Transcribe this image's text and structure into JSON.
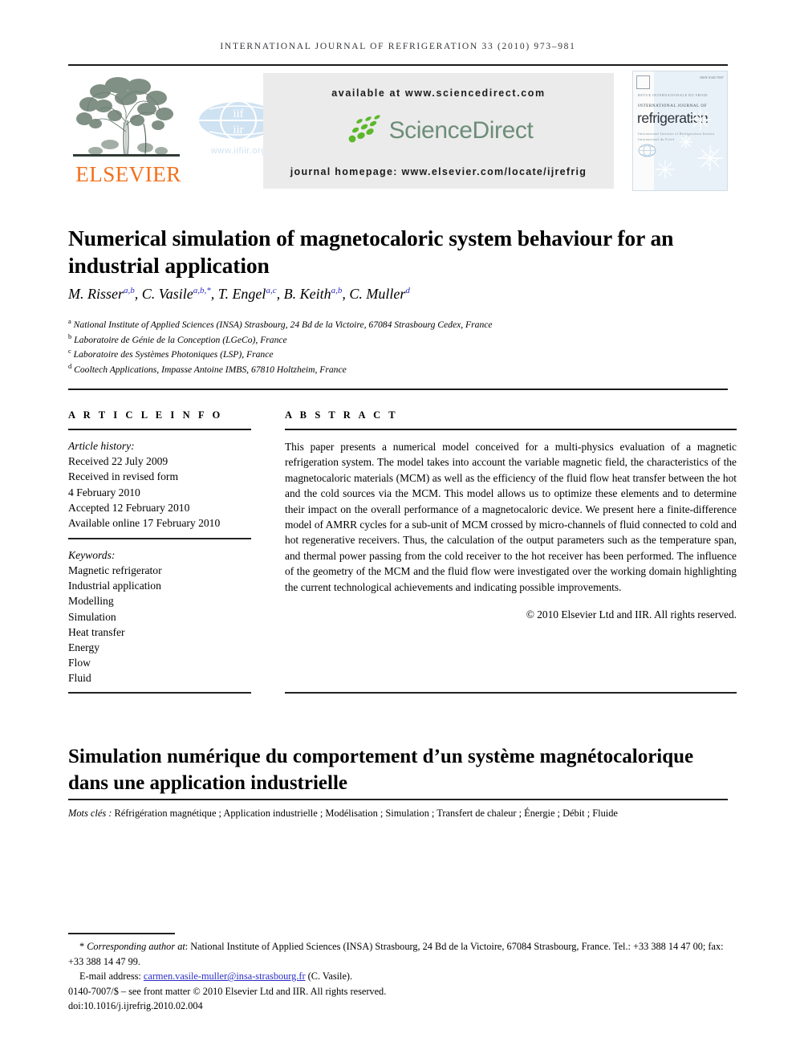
{
  "running_head": "International Journal of Refrigeration 33 (2010) 973–981",
  "masthead": {
    "publisher_name": "ELSEVIER",
    "publisher_logo_icon": "elsevier-tree-logo",
    "iif_logo_icon": "iif-iir-globe-logo",
    "iif_url": "www.iifiir.org",
    "available_at": "available at www.sciencedirect.com",
    "sciencedirect_wordmark": "ScienceDirect",
    "sciencedirect_logo_icon": "sciencedirect-swoosh-icon",
    "journal_homepage": "journal homepage: www.elsevier.com/locate/ijrefrig",
    "cover": {
      "issn_line": "ISSN 0140-7007",
      "pub_line": "REVUE INTERNATIONALE DU FROID",
      "eyebrow": "INTERNATIONAL JOURNAL OF",
      "title": "refrigeration",
      "subtitle": "International Institute of Refrigeration\nInstitut International du Froid",
      "globe_icon": "iif-iir-globe-logo",
      "snowflake_icon": "snowflake-icon"
    }
  },
  "article": {
    "title": "Numerical simulation of magnetocaloric system behaviour for an industrial application",
    "authors": [
      {
        "name": "M. Risser",
        "marks": "a,b",
        "sep": ", "
      },
      {
        "name": "C. Vasile",
        "marks": "a,b,*",
        "sep": ", "
      },
      {
        "name": "T. Engel",
        "marks": "a,c",
        "sep": ", "
      },
      {
        "name": "B. Keith",
        "marks": "a,b",
        "sep": ", "
      },
      {
        "name": "C. Muller",
        "marks": "d",
        "sep": ""
      }
    ],
    "affiliations": [
      {
        "mark": "a",
        "text": "National Institute of Applied Sciences (INSA) Strasbourg, 24 Bd de la Victoire, 67084 Strasbourg Cedex, France"
      },
      {
        "mark": "b",
        "text": "Laboratoire de Génie de la Conception (LGeCo), France"
      },
      {
        "mark": "c",
        "text": "Laboratoire des Systèmes Photoniques (LSP), France"
      },
      {
        "mark": "d",
        "text": "Cooltech Applications, Impasse Antoine IMBS, 67810 Holtzheim, France"
      }
    ]
  },
  "article_info": {
    "heading": "A R T I C L E   I N F O",
    "history_label": "Article history:",
    "history": [
      "Received 22 July 2009",
      "Received in revised form",
      "4 February 2010",
      "Accepted 12 February 2010",
      "Available online 17 February 2010"
    ],
    "keywords_label": "Keywords:",
    "keywords": [
      "Magnetic refrigerator",
      "Industrial application",
      "Modelling",
      "Simulation",
      "Heat transfer",
      "Energy",
      "Flow",
      "Fluid"
    ]
  },
  "abstract": {
    "heading": "A B S T R A C T",
    "text": "This paper presents a numerical model conceived for a multi-physics evaluation of a magnetic refrigeration system. The model takes into account the variable magnetic field, the characteristics of the magnetocaloric materials (MCM) as well as the efficiency of the fluid flow heat transfer between the hot and the cold sources via the MCM. This model allows us to optimize these elements and to determine their impact on the overall performance of a magnetocaloric device. We present here a finite-difference model of AMRR cycles for a sub-unit of MCM crossed by micro-channels of fluid connected to cold and hot regenerative receivers. Thus, the calculation of the output parameters such as the temperature span, and thermal power passing from the cold receiver to the hot receiver has been performed. The influence of the geometry of the MCM and the fluid flow were investigated over the working domain highlighting the current technological achievements and indicating possible improvements.",
    "copyright": "© 2010 Elsevier Ltd and IIR. All rights reserved."
  },
  "french": {
    "title": "Simulation numérique du comportement d’un système magnétocalorique dans une application industrielle",
    "keywords_label": "Mots clés :",
    "keywords_text": "Réfrigération magnétique ; Application industrielle ; Modélisation ; Simulation ; Transfert de chaleur ; Énergie ; Débit ; Fluide"
  },
  "footnotes": {
    "corresponding_star": "*",
    "corresponding_label": "Corresponding author at",
    "corresponding_text": ": National Institute of Applied Sciences (INSA) Strasbourg, 24 Bd de la Victoire, 67084 Strasbourg, France. Tel.: +33 388 14 47 00; fax: +33 388 14 47 99.",
    "email_label": "E-mail address:",
    "email": "carmen.vasile-muller@insa-strasbourg.fr",
    "email_suffix": "(C. Vasile).",
    "front_matter": "0140-7007/$ – see front matter © 2010 Elsevier Ltd and IIR. All rights reserved.",
    "doi": "doi:10.1016/j.ijrefrig.2010.02.004"
  },
  "colors": {
    "elsevier_orange": "#f3701b",
    "link_blue": "#2c2cc8",
    "sciencedirect_green": "#5cb82b",
    "sciencedirect_gray": "#6d8d79",
    "iif_blue": "#cfe2f2",
    "banner_gray": "#ebebeb",
    "cover_blue": "#e8f1f8"
  }
}
